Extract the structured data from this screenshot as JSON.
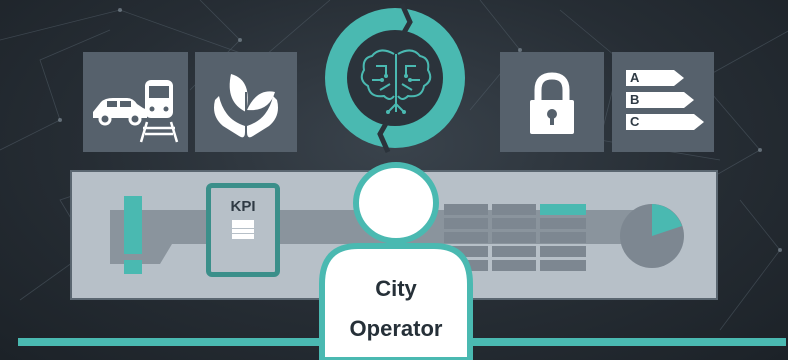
{
  "energy_label": {
    "classes": [
      "A",
      "B",
      "C"
    ]
  },
  "dashboard": {
    "kpi_label": "KPI"
  },
  "user": {
    "label_line1": "City",
    "label_line2": "Operator"
  },
  "colors": {
    "accent": "#4ab9b1",
    "tile": "#56616c",
    "panel": "#b7c0c8",
    "dark": "#2f3a44"
  },
  "icons": [
    "car-icon",
    "train-icon",
    "plant-hands-icon",
    "brain-circuit-icon",
    "cycle-arrows-icon",
    "lock-icon",
    "energy-label-icon",
    "exclamation-icon",
    "kpi-card-icon",
    "table-icon",
    "pie-chart-icon",
    "person-icon"
  ]
}
